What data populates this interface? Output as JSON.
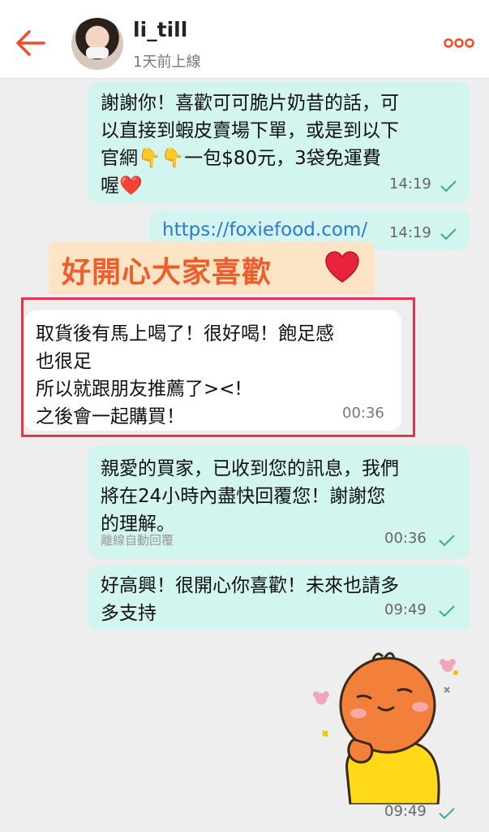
{
  "header": {
    "username": "li_till",
    "status": "1天前上線"
  },
  "messages": [
    {
      "text": "謝謝你！喜歡可可脆片奶昔的話，可\n以直接到蝦皮賣場下單，或是到以下\n官網👇👇一包$80元，3袋免運費\n喔❤️",
      "time": "14:19"
    },
    {
      "text": "https://foxiefood.com/",
      "time": "14:19"
    },
    {
      "text": "取貨後有馬上喝了！很好喝！飽足感\n也很足\n所以就跟朋友推薦了><!\n之後會一起購買！",
      "time": "00:36"
    },
    {
      "text": "親愛的買家，已收到您的訊息，我們\n將在24小時內盡快回覆您！謝謝您\n的理解。",
      "sub": "離線自動回覆",
      "time": "00:36"
    },
    {
      "text": "好高興！很開心你喜歡！未來也請多\n多支持",
      "time": "09:49"
    },
    {
      "time": "09:49"
    }
  ],
  "banner": {
    "text": "好開心大家喜歡",
    "icon": "heart-icon"
  },
  "colors": {
    "accent": "#ee4d2d",
    "outgoing_bubble": "#d3f5ef",
    "incoming_bubble": "#ffffff",
    "highlight": "#e8334f",
    "link": "#2f77d4"
  }
}
